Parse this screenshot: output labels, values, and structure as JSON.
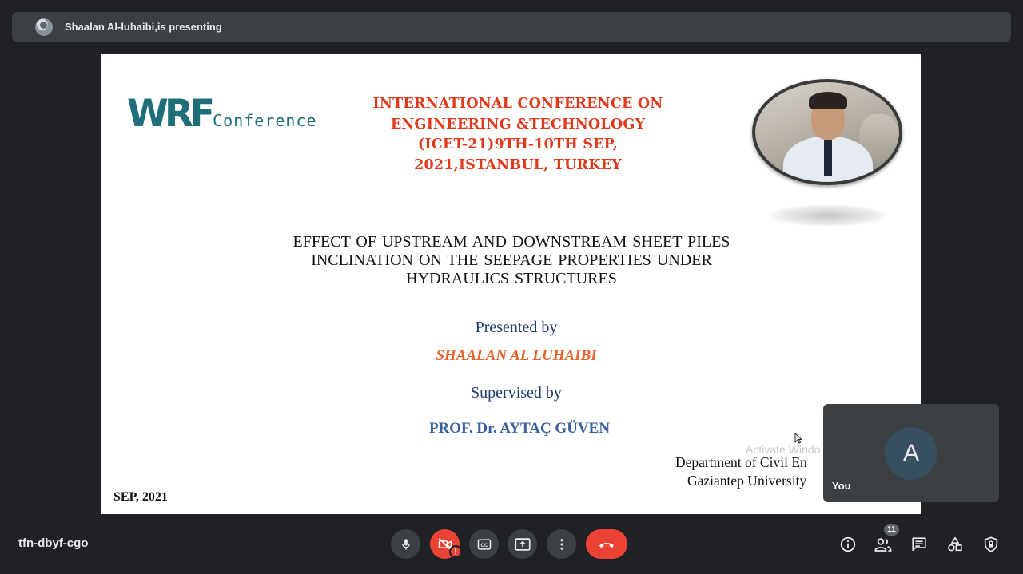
{
  "presenter_bar": {
    "text": "Shaalan Al-luhaibi,is presenting"
  },
  "slide": {
    "logo": {
      "mark": "WRF",
      "word": "Conference"
    },
    "conference_title": "INTERNATIONAL CONFERENCE ON ENGINEERING &TECHNOLOGY (ICET-21)9TH-10TH SEP, 2021,ISTANBUL, TURKEY",
    "paper_title": "EFFECT OF UPSTREAM AND DOWNSTREAM SHEET PILES INCLINATION ON THE SEEPAGE PROPERTIES UNDER HYDRAULICS STRUCTURES",
    "presented_by_label": "Presented by",
    "presenter_name": "SHAALAN AL LUHAIBI",
    "supervised_by_label": "Supervised by",
    "supervisor_name": "PROF. Dr. AYTAÇ GÜVEN",
    "department": "Department of Civil En",
    "university": "Gaziantep University",
    "date": "SEP, 2021",
    "activate_watermark": "Activate Windo"
  },
  "self_tile": {
    "avatar_letter": "A",
    "label": "You"
  },
  "bottom_bar": {
    "meeting_code": "tfn-dbyf-cgo",
    "camera_alert": "!",
    "participants_count": "11"
  },
  "icons": {
    "mic": "microphone-icon",
    "camera_off": "video-off-icon",
    "captions": "closed-captions-icon",
    "present": "present-screen-icon",
    "more": "more-vertical-icon",
    "leave": "call-end-icon",
    "info": "info-icon",
    "people": "people-icon",
    "chat": "chat-icon",
    "activities": "activities-icon",
    "host_controls": "shield-lock-icon"
  },
  "colors": {
    "background": "#202124",
    "bar": "#3c4043",
    "leave_red": "#ea4335",
    "conference_title_red": "#e03a1c",
    "presenter_orange": "#e8622a",
    "logo_teal": "#1f6f7a"
  }
}
